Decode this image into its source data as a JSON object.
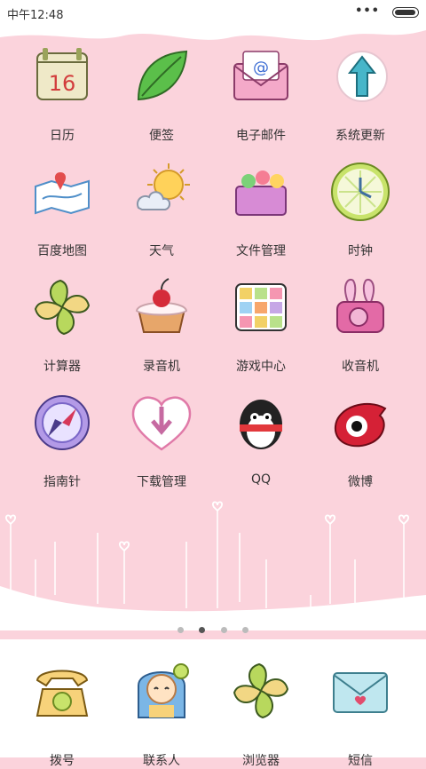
{
  "status": {
    "time": "中午12:48"
  },
  "apps": [
    {
      "label": "日历",
      "icon": "calendar-icon"
    },
    {
      "label": "便签",
      "icon": "leaf-note-icon"
    },
    {
      "label": "电子邮件",
      "icon": "email-envelope-icon"
    },
    {
      "label": "系统更新",
      "icon": "update-arrow-icon"
    },
    {
      "label": "百度地图",
      "icon": "map-icon"
    },
    {
      "label": "天气",
      "icon": "weather-sun-cloud-icon"
    },
    {
      "label": "文件管理",
      "icon": "file-box-icon"
    },
    {
      "label": "时钟",
      "icon": "clock-lemon-icon"
    },
    {
      "label": "计算器",
      "icon": "calculator-swirl-icon"
    },
    {
      "label": "录音机",
      "icon": "recorder-cake-icon"
    },
    {
      "label": "游戏中心",
      "icon": "rubik-cube-icon"
    },
    {
      "label": "收音机",
      "icon": "radio-bunny-icon"
    },
    {
      "label": "指南针",
      "icon": "compass-icon"
    },
    {
      "label": "下载管理",
      "icon": "download-heart-icon"
    },
    {
      "label": "QQ",
      "icon": "qq-penguin-icon"
    },
    {
      "label": "微博",
      "icon": "weibo-eye-icon"
    }
  ],
  "dock": [
    {
      "label": "拨号",
      "icon": "telephone-icon"
    },
    {
      "label": "联系人",
      "icon": "contacts-girl-icon"
    },
    {
      "label": "浏览器",
      "icon": "browser-swirl-icon"
    },
    {
      "label": "短信",
      "icon": "sms-envelope-icon"
    }
  ],
  "pager": {
    "pages": 4,
    "active": 2
  }
}
